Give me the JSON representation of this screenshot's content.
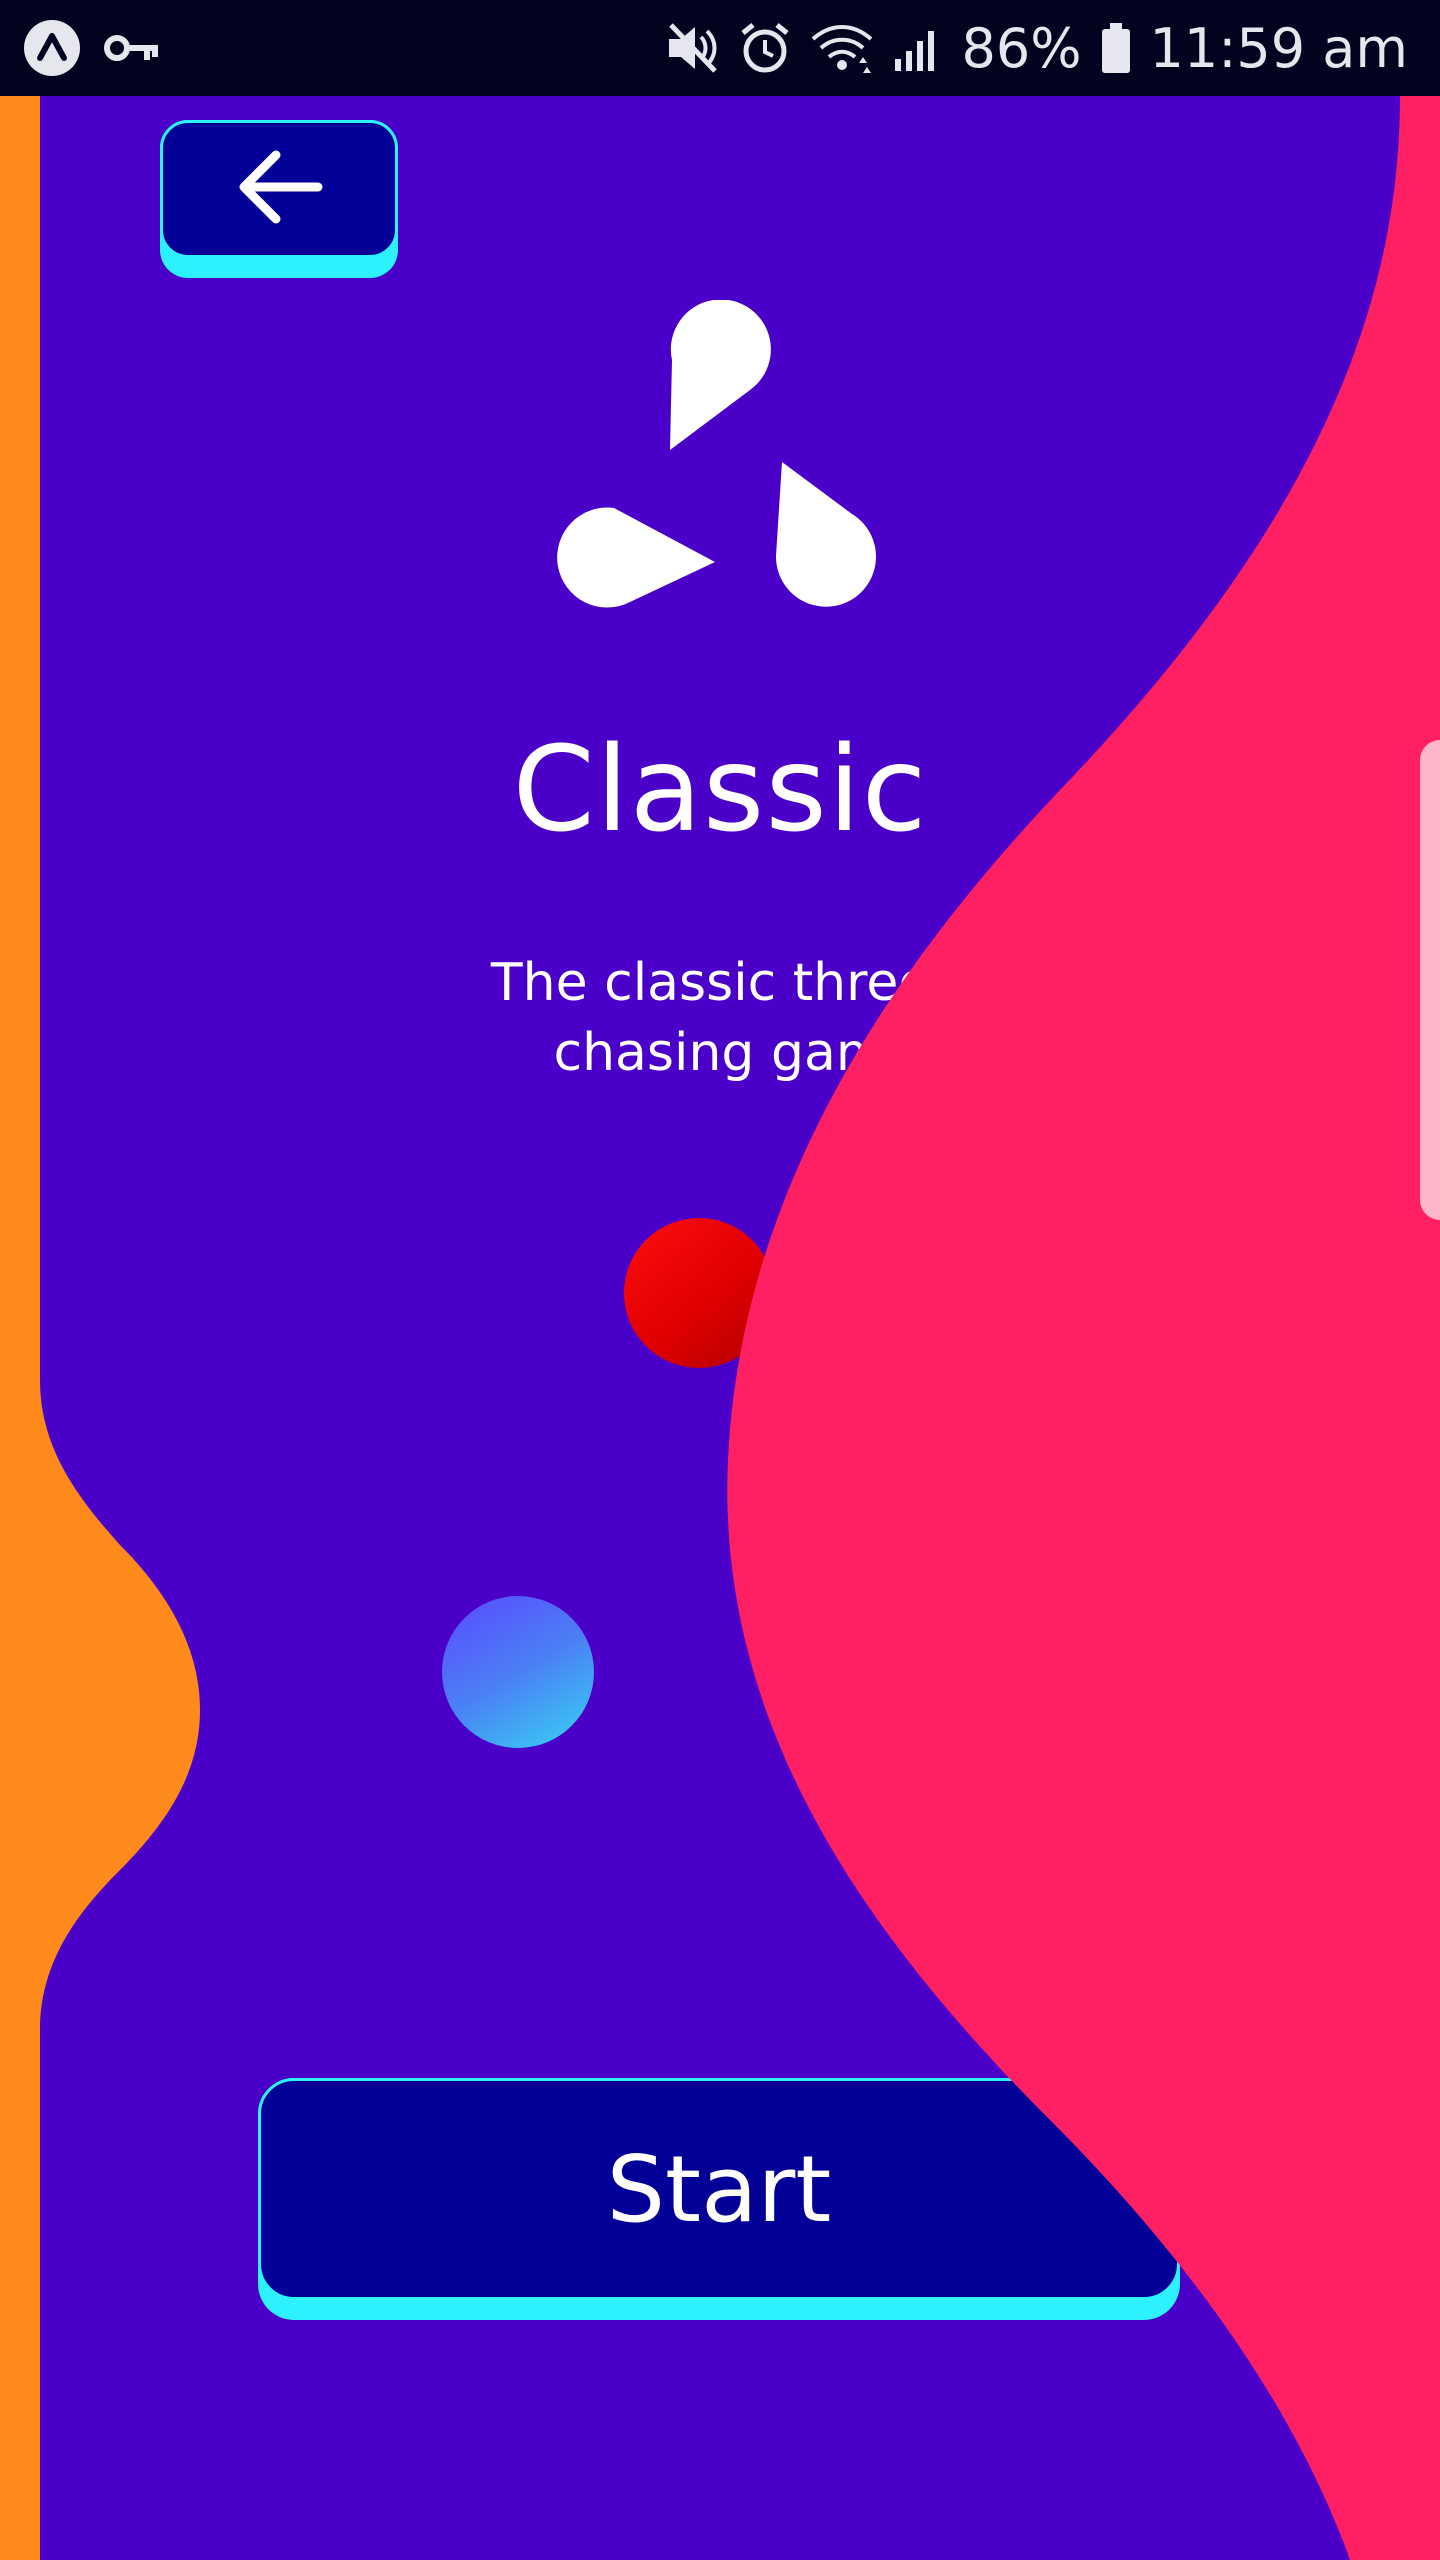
{
  "status_bar": {
    "battery": "86%",
    "time": "11:59 am",
    "icons": [
      "app-a-icon",
      "key-icon",
      "mute-icon",
      "alarm-icon",
      "wifi-icon",
      "signal-icon",
      "battery-icon"
    ]
  },
  "screen": {
    "back_button": {
      "icon": "arrow-left-icon"
    },
    "logo_icon": "three-drops-logo-icon",
    "title": "Classic",
    "subtitle_line1": "The classic three-",
    "subtitle_line2": "chasing gam",
    "start_label": "Start"
  },
  "colors": {
    "background": "#4a00c8",
    "orange": "#ff8a1c",
    "pink": "#ff1f63",
    "button_face": "#020096",
    "button_accent": "#2ef1ff",
    "red_dot": "#ff0d0d",
    "blue_dot": "#4b7ff5"
  }
}
